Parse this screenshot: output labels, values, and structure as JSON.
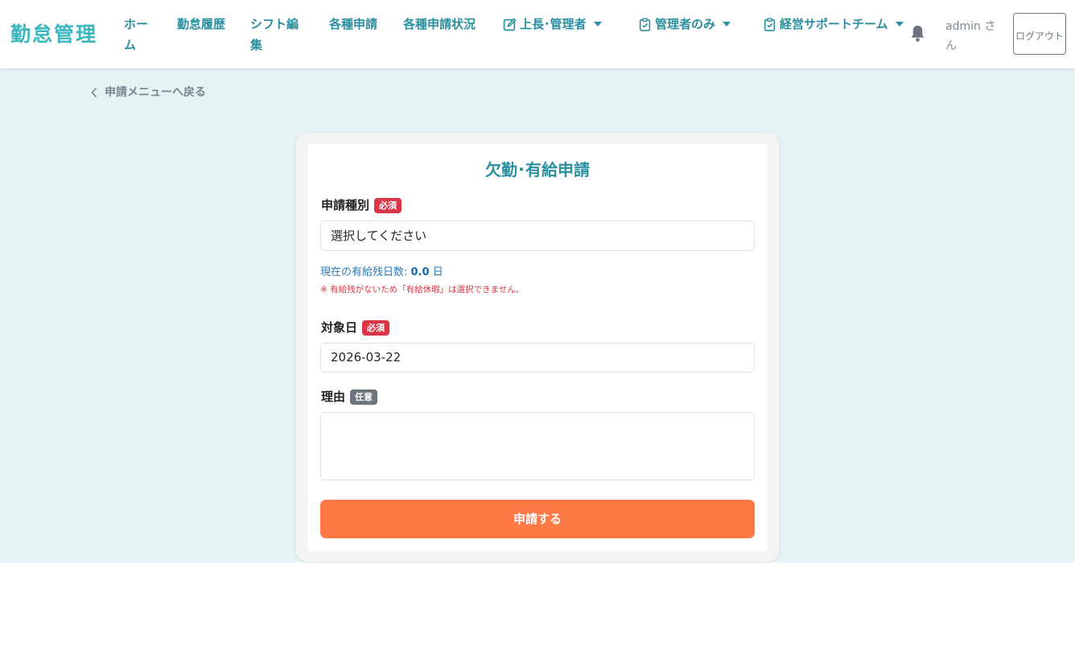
{
  "brand": "勤怠管理",
  "nav": {
    "home": "ホーム",
    "history": "勤怠履歴",
    "shift_edit": "シフト編集",
    "requests": "各種申請",
    "request_status": "各種申請状況",
    "boss_admin": "上長･管理者",
    "admin_only": "管理者のみ",
    "mgmt_support": "経営サポートチーム"
  },
  "user": {
    "name": "admin さん"
  },
  "logout_label": "ログアウト",
  "back_link": "申請メニューへ戻る",
  "form": {
    "title": "欠勤･有給申請",
    "type_label": "申請種別",
    "required_badge": "必須",
    "optional_badge": "任意",
    "type_value": "選択してください",
    "balance_prefix": "現在の有給残日数: ",
    "balance_value": "0.0",
    "balance_unit": "日",
    "warning": "※ 有給残がないため「有給休暇」は選択できません。",
    "date_label": "対象日",
    "date_value": "2026-03-22",
    "reason_label": "理由",
    "reason_value": "",
    "submit_label": "申請する"
  },
  "colors": {
    "brand": "#3bb7bd",
    "nav_text": "#2a8f9f",
    "background": "#e7f2f4",
    "submit": "#ff7a45",
    "required": "#dc3545",
    "optional": "#6c757d"
  },
  "icons": [
    "edit-icon",
    "clipboard-check-icon",
    "bell-icon",
    "chevron-left-icon"
  ]
}
